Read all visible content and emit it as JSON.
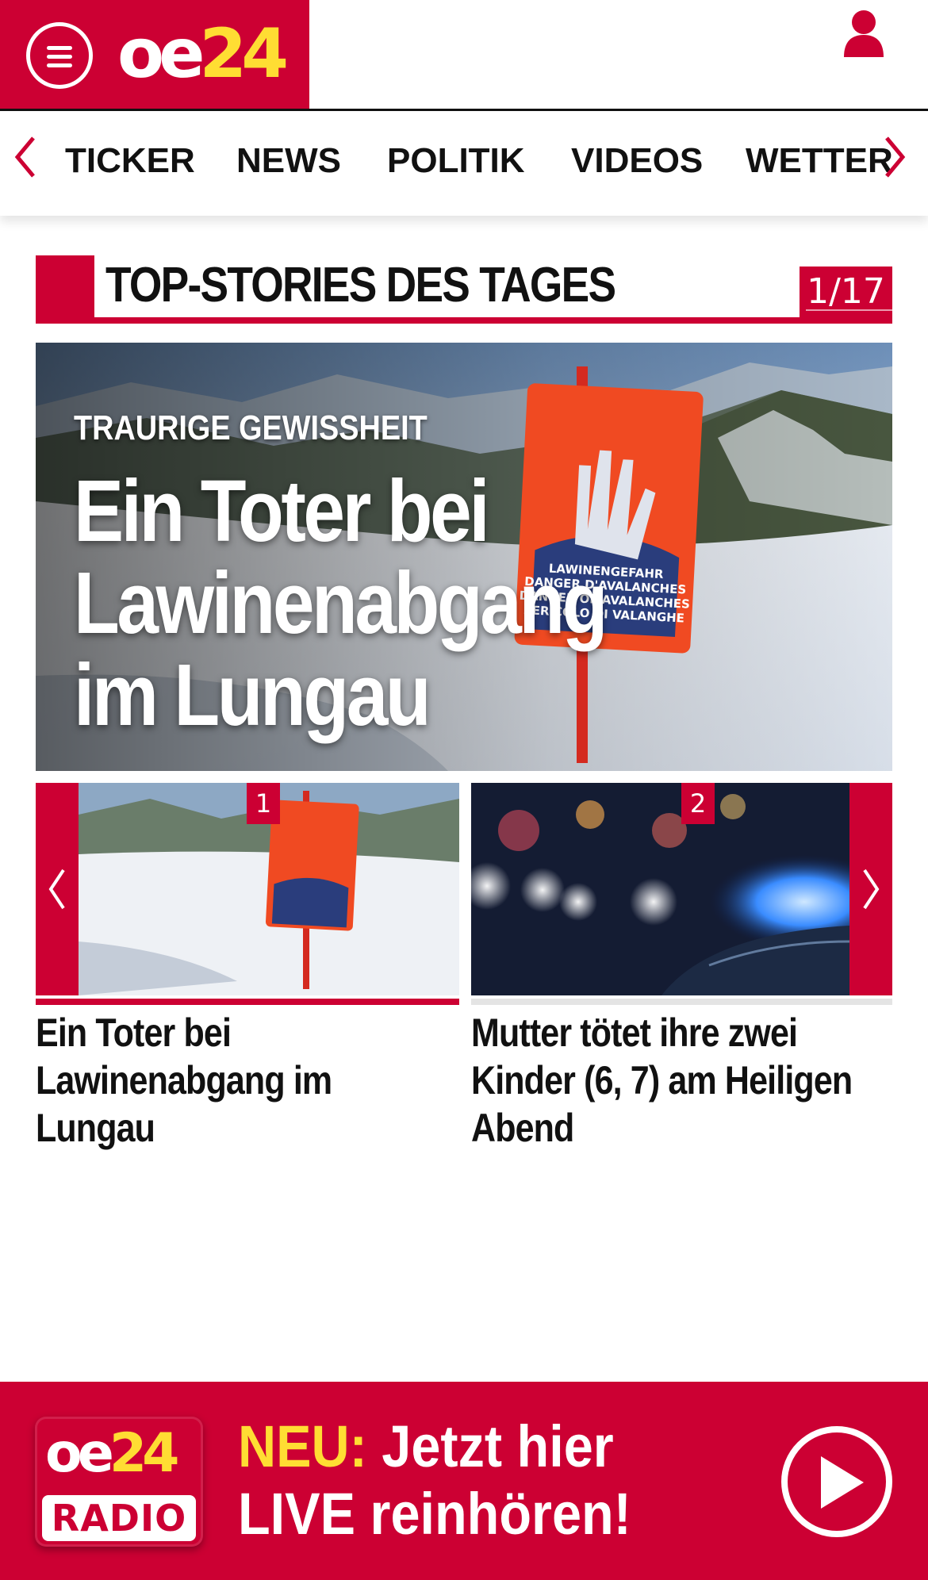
{
  "header": {
    "logo": {
      "oe": "oe",
      "num": "24"
    },
    "menu_icon": "hamburger-menu-icon",
    "user_icon": "user-icon"
  },
  "nav": {
    "items": [
      "TICKER",
      "NEWS",
      "POLITIK",
      "VIDEOS",
      "WETTER"
    ],
    "prev_icon": "chevron-left-icon",
    "next_icon": "chevron-right-icon"
  },
  "section": {
    "title": "TOP-STORIES DES TAGES",
    "counter": "1/17"
  },
  "hero": {
    "kicker": "TRAURIGE GEWISSHEIT",
    "title": "Ein Toter bei Lawinenabgang im Lungau",
    "sign_lines": [
      "LAWINENGEFAHR",
      "DANGER D'AVALANCHES",
      "DANGER OF AVALANCHES",
      "PERICOLO DI VALANGHE"
    ]
  },
  "carousel": {
    "cards": [
      {
        "badge": "1",
        "title": "Ein Toter bei Lawinenabgang im Lungau",
        "active": true
      },
      {
        "badge": "2",
        "title": "Mutter tötet ihre zwei Kinder (6, 7) am Heiligen Abend",
        "active": false
      }
    ],
    "prev_icon": "chevron-left-icon",
    "next_icon": "chevron-right-icon"
  },
  "radio": {
    "logo_top": {
      "oe": "oe",
      "num": "24"
    },
    "logo_bottom": "RADIO",
    "neu": "NEU:",
    "line1_rest": " Jetzt hier",
    "line2": "LIVE reinhören!",
    "play_icon": "play-icon"
  },
  "colors": {
    "brand_red": "#cc0033",
    "brand_yellow": "#ffdd33",
    "text": "#111111"
  }
}
